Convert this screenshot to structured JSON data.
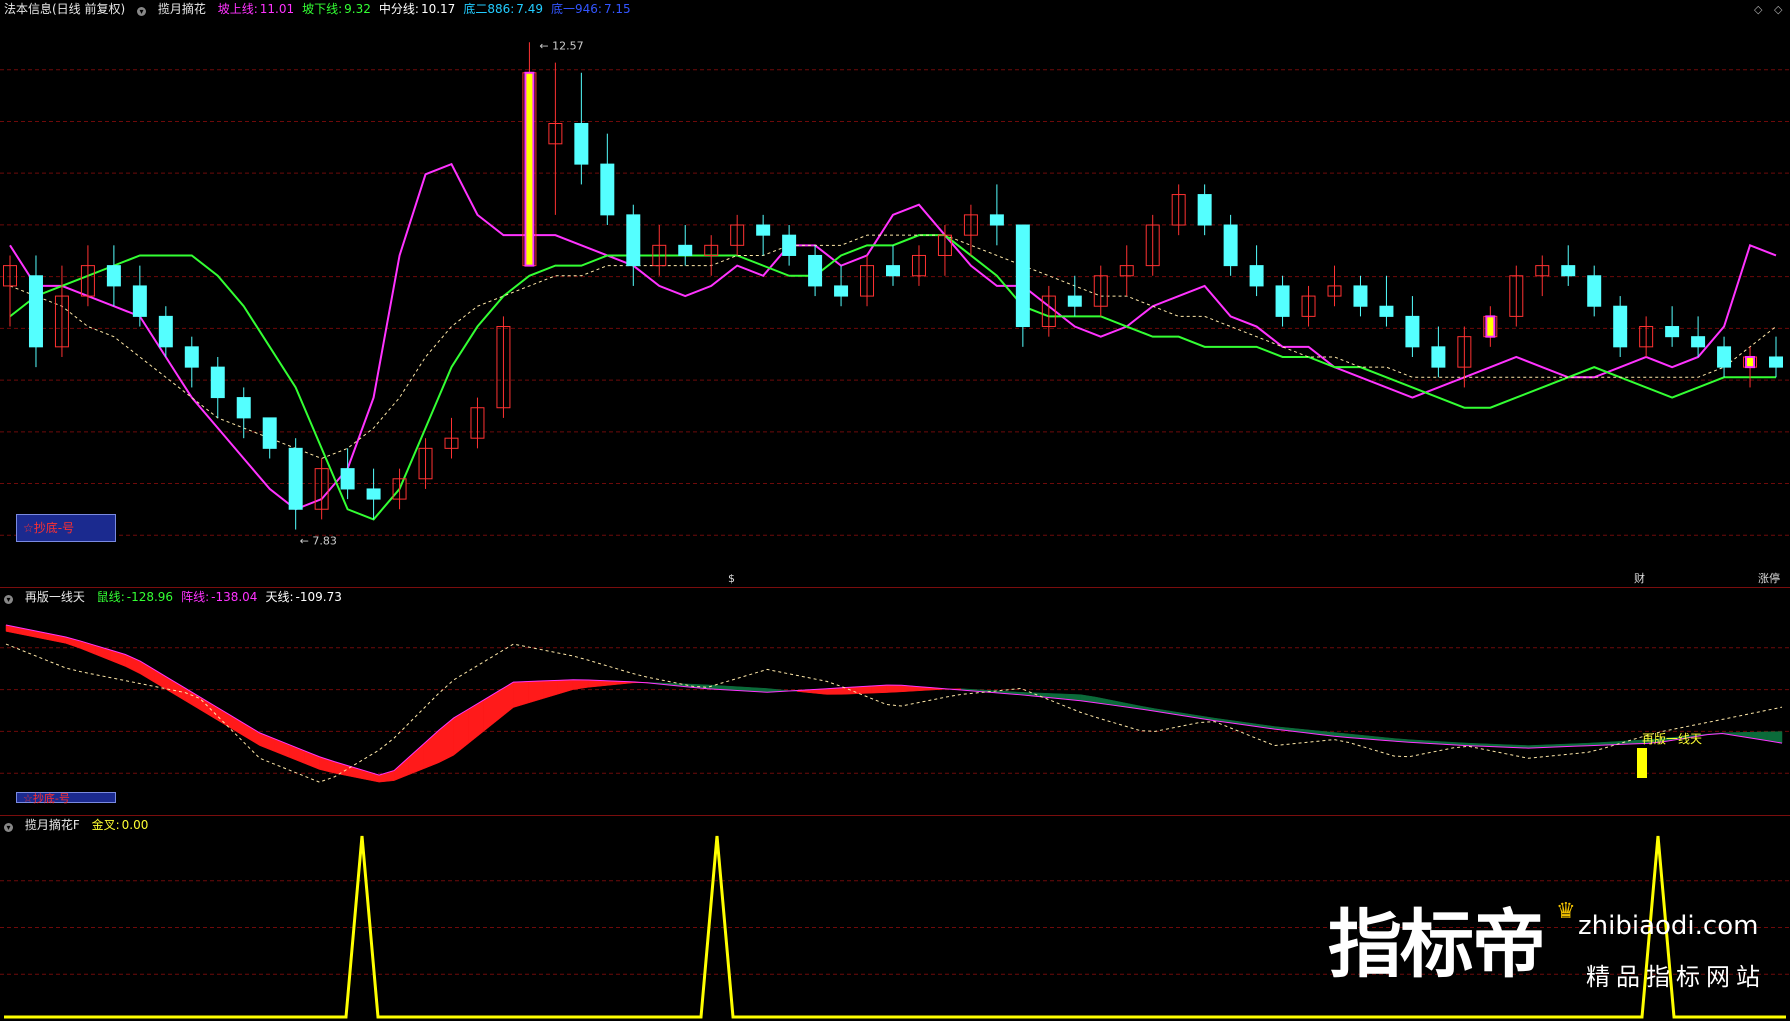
{
  "panel_main": {
    "title": "法本信息(日线 前复权)",
    "indicator_name": "揽月摘花",
    "legend": [
      {
        "label": "坡上线",
        "value": "11.01",
        "color": "#ff33ff"
      },
      {
        "label": "坡下线",
        "value": "9.32",
        "color": "#33ff33"
      },
      {
        "label": "中分线",
        "value": "10.17",
        "color": "#ffffff"
      },
      {
        "label": "底二886",
        "value": "7.49",
        "color": "#22ccff"
      },
      {
        "label": "底一946",
        "value": "7.15",
        "color": "#3355ff"
      }
    ],
    "high_label": "12.57",
    "low_label": "7.83",
    "badge_text": "☆抄底-号",
    "markers": [
      {
        "text": "$",
        "color": "#ff3333"
      },
      {
        "text": "财",
        "color": "#7fa8ff"
      },
      {
        "text": "涨停",
        "color": "#ff6666"
      }
    ],
    "right_icons": [
      "◇",
      "◇"
    ]
  },
  "panel_sub1": {
    "title": "再版一线天",
    "legend": [
      {
        "label": "鼠线",
        "value": "-128.96",
        "color": "#33ff33"
      },
      {
        "label": "阵线",
        "value": "-138.04",
        "color": "#ff33ff"
      },
      {
        "label": "天线",
        "value": "-109.73",
        "color": "#ffffff"
      }
    ],
    "badge_text": "☆抄底-号",
    "signal_label": "再版一线天"
  },
  "panel_sub2": {
    "title": "揽月摘花F",
    "legend": [
      {
        "label": "金叉",
        "value": "0.00",
        "color": "#ffff33"
      }
    ]
  },
  "watermark": {
    "main": "指标帝",
    "url": "zhibiaodi.com",
    "sub": "精品指标网站"
  },
  "colors": {
    "up": "#ff3232",
    "down": "#54ffff",
    "ma_magenta": "#ff33ff",
    "ma_green": "#33ff33",
    "mid_dashed": "#ffe8a8",
    "grid": "#6e0a0a",
    "band_green": "#0b6b3a",
    "band_red": "#ff1a1a",
    "signal": "#ffff00"
  },
  "chart_data": [
    {
      "type": "candlestick",
      "title": "揽月摘花",
      "ylim": [
        7.5,
        12.8
      ],
      "series": [
        {
          "name": "坡上线",
          "values": [
            10.6,
            10.2,
            10.2,
            10.1,
            10.0,
            9.9,
            9.5,
            9.1,
            8.8,
            8.5,
            8.2,
            8.0,
            8.1,
            8.4,
            9.1,
            10.5,
            11.3,
            11.4,
            10.9,
            10.7,
            10.7,
            10.7,
            10.6,
            10.5,
            10.4,
            10.2,
            10.1,
            10.2,
            10.4,
            10.3,
            10.6,
            10.6,
            10.4,
            10.5,
            10.9,
            11.0,
            10.7,
            10.4,
            10.2,
            10.2,
            10.0,
            9.8,
            9.7,
            9.8,
            10.0,
            10.1,
            10.2,
            9.9,
            9.8,
            9.6,
            9.6,
            9.4,
            9.3,
            9.2,
            9.1,
            9.2,
            9.3,
            9.4,
            9.5,
            9.4,
            9.3,
            9.3,
            9.4,
            9.5,
            9.4,
            9.5,
            9.8,
            10.6,
            10.5
          ]
        },
        {
          "name": "坡下线",
          "values": [
            9.9,
            10.1,
            10.2,
            10.3,
            10.4,
            10.5,
            10.5,
            10.5,
            10.3,
            10.0,
            9.6,
            9.2,
            8.6,
            8.0,
            7.9,
            8.2,
            8.8,
            9.4,
            9.8,
            10.1,
            10.3,
            10.4,
            10.4,
            10.5,
            10.5,
            10.5,
            10.5,
            10.5,
            10.5,
            10.4,
            10.3,
            10.3,
            10.5,
            10.6,
            10.6,
            10.7,
            10.7,
            10.5,
            10.3,
            10.0,
            9.9,
            9.9,
            9.9,
            9.8,
            9.7,
            9.7,
            9.6,
            9.6,
            9.6,
            9.5,
            9.5,
            9.4,
            9.4,
            9.3,
            9.2,
            9.1,
            9.0,
            9.0,
            9.1,
            9.2,
            9.3,
            9.4,
            9.3,
            9.2,
            9.1,
            9.2,
            9.3,
            9.3,
            9.3
          ]
        },
        {
          "name": "中分线",
          "values": [
            10.2,
            10.1,
            10.0,
            9.8,
            9.7,
            9.5,
            9.3,
            9.1,
            8.9,
            8.8,
            8.7,
            8.6,
            8.5,
            8.6,
            8.8,
            9.1,
            9.5,
            9.8,
            10.0,
            10.1,
            10.2,
            10.3,
            10.3,
            10.4,
            10.4,
            10.4,
            10.4,
            10.4,
            10.5,
            10.5,
            10.6,
            10.6,
            10.6,
            10.7,
            10.7,
            10.7,
            10.7,
            10.6,
            10.5,
            10.4,
            10.3,
            10.2,
            10.1,
            10.1,
            10.0,
            9.9,
            9.9,
            9.8,
            9.7,
            9.6,
            9.5,
            9.5,
            9.4,
            9.4,
            9.3,
            9.3,
            9.3,
            9.3,
            9.3,
            9.3,
            9.3,
            9.3,
            9.3,
            9.3,
            9.3,
            9.3,
            9.4,
            9.6,
            9.8
          ]
        }
      ],
      "candles_ohlc": [
        [
          10.2,
          10.5,
          9.8,
          10.4
        ],
        [
          10.3,
          10.5,
          9.4,
          9.6
        ],
        [
          9.6,
          10.4,
          9.5,
          10.1
        ],
        [
          10.1,
          10.6,
          10.0,
          10.4
        ],
        [
          10.4,
          10.6,
          10.0,
          10.2
        ],
        [
          10.2,
          10.4,
          9.8,
          9.9
        ],
        [
          9.9,
          10.0,
          9.5,
          9.6
        ],
        [
          9.6,
          9.7,
          9.2,
          9.4
        ],
        [
          9.4,
          9.5,
          8.9,
          9.1
        ],
        [
          9.1,
          9.2,
          8.7,
          8.9
        ],
        [
          8.9,
          8.9,
          8.5,
          8.6
        ],
        [
          8.6,
          8.7,
          7.8,
          8.0
        ],
        [
          8.0,
          8.5,
          7.9,
          8.4
        ],
        [
          8.4,
          8.6,
          8.1,
          8.2
        ],
        [
          8.2,
          8.4,
          7.9,
          8.1
        ],
        [
          8.1,
          8.4,
          8.0,
          8.3
        ],
        [
          8.3,
          8.7,
          8.2,
          8.6
        ],
        [
          8.6,
          8.9,
          8.5,
          8.7
        ],
        [
          8.7,
          9.1,
          8.6,
          9.0
        ],
        [
          9.0,
          9.9,
          8.9,
          9.8
        ],
        [
          10.4,
          12.6,
          10.4,
          12.3
        ],
        [
          11.6,
          12.4,
          10.9,
          11.8
        ],
        [
          11.8,
          12.3,
          11.2,
          11.4
        ],
        [
          11.4,
          11.7,
          10.8,
          10.9
        ],
        [
          10.9,
          11.0,
          10.2,
          10.4
        ],
        [
          10.4,
          10.8,
          10.3,
          10.6
        ],
        [
          10.6,
          10.8,
          10.4,
          10.5
        ],
        [
          10.5,
          10.7,
          10.3,
          10.6
        ],
        [
          10.6,
          10.9,
          10.5,
          10.8
        ],
        [
          10.8,
          10.9,
          10.5,
          10.7
        ],
        [
          10.7,
          10.8,
          10.4,
          10.5
        ],
        [
          10.5,
          10.6,
          10.1,
          10.2
        ],
        [
          10.2,
          10.4,
          10.0,
          10.1
        ],
        [
          10.1,
          10.5,
          10.0,
          10.4
        ],
        [
          10.4,
          10.6,
          10.2,
          10.3
        ],
        [
          10.3,
          10.6,
          10.2,
          10.5
        ],
        [
          10.5,
          10.8,
          10.3,
          10.7
        ],
        [
          10.7,
          11.0,
          10.5,
          10.9
        ],
        [
          10.9,
          11.2,
          10.6,
          10.8
        ],
        [
          10.8,
          10.8,
          9.6,
          9.8
        ],
        [
          9.8,
          10.2,
          9.7,
          10.1
        ],
        [
          10.1,
          10.3,
          9.9,
          10.0
        ],
        [
          10.0,
          10.4,
          9.9,
          10.3
        ],
        [
          10.3,
          10.6,
          10.1,
          10.4
        ],
        [
          10.4,
          10.9,
          10.3,
          10.8
        ],
        [
          10.8,
          11.2,
          10.7,
          11.1
        ],
        [
          11.1,
          11.2,
          10.7,
          10.8
        ],
        [
          10.8,
          10.9,
          10.3,
          10.4
        ],
        [
          10.4,
          10.6,
          10.1,
          10.2
        ],
        [
          10.2,
          10.3,
          9.8,
          9.9
        ],
        [
          9.9,
          10.2,
          9.8,
          10.1
        ],
        [
          10.1,
          10.4,
          10.0,
          10.2
        ],
        [
          10.2,
          10.3,
          9.9,
          10.0
        ],
        [
          10.0,
          10.3,
          9.8,
          9.9
        ],
        [
          9.9,
          10.1,
          9.5,
          9.6
        ],
        [
          9.6,
          9.8,
          9.3,
          9.4
        ],
        [
          9.4,
          9.8,
          9.2,
          9.7
        ],
        [
          9.7,
          10.0,
          9.6,
          9.9
        ],
        [
          9.9,
          10.4,
          9.8,
          10.3
        ],
        [
          10.3,
          10.5,
          10.1,
          10.4
        ],
        [
          10.4,
          10.6,
          10.2,
          10.3
        ],
        [
          10.3,
          10.4,
          9.9,
          10.0
        ],
        [
          10.0,
          10.1,
          9.5,
          9.6
        ],
        [
          9.6,
          9.9,
          9.5,
          9.8
        ],
        [
          9.8,
          10.0,
          9.6,
          9.7
        ],
        [
          9.7,
          9.9,
          9.5,
          9.6
        ],
        [
          9.6,
          9.7,
          9.3,
          9.4
        ],
        [
          9.4,
          9.6,
          9.2,
          9.5
        ],
        [
          9.5,
          9.7,
          9.3,
          9.4
        ]
      ],
      "labels": [
        "12.57",
        "7.83"
      ]
    },
    {
      "type": "area",
      "title": "再版一线天",
      "series": [
        {
          "name": "鼠线",
          "values": [
            -50,
            -60,
            -80,
            -110,
            -140,
            -160,
            -170,
            -150,
            -110,
            -95,
            -90,
            -92,
            -95,
            -100,
            -98,
            -95,
            -98,
            -100,
            -110,
            -118,
            -125,
            -130,
            -135,
            -138,
            -140,
            -138,
            -135,
            -130,
            -128.96
          ]
        },
        {
          "name": "阵线",
          "values": [
            -45,
            -55,
            -70,
            -100,
            -130,
            -150,
            -165,
            -120,
            -90,
            -88,
            -90,
            -95,
            -98,
            -95,
            -92,
            -96,
            -100,
            -105,
            -112,
            -120,
            -127,
            -133,
            -137,
            -140,
            -142,
            -140,
            -138,
            -130,
            -138.04
          ]
        },
        {
          "name": "天线",
          "values": [
            -60,
            -80,
            -90,
            -100,
            -150,
            -170,
            -140,
            -90,
            -60,
            -70,
            -85,
            -95,
            -80,
            -90,
            -110,
            -100,
            -95,
            -115,
            -130,
            -120,
            -140,
            -135,
            -150,
            -140,
            -150,
            -145,
            -130,
            -120,
            -109.73
          ]
        }
      ]
    },
    {
      "type": "line",
      "title": "揽月摘花F",
      "series": [
        {
          "name": "金叉",
          "values": [
            0,
            0,
            0,
            1,
            0,
            0,
            0,
            1,
            0,
            0,
            0,
            0,
            0,
            0,
            0,
            0,
            0,
            1,
            0,
            0.0
          ]
        }
      ]
    }
  ]
}
